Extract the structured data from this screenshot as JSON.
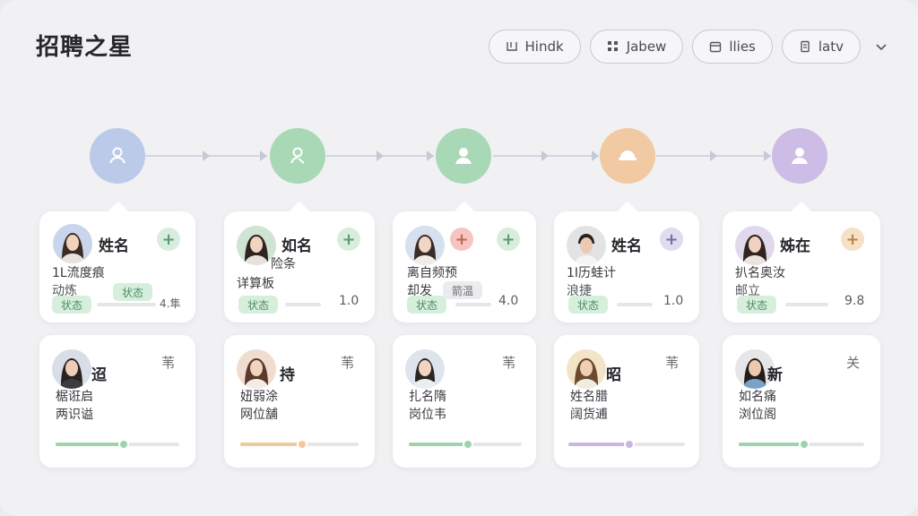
{
  "app": {
    "title": "招聘之星"
  },
  "toolbar": {
    "buttons": [
      {
        "label": "Hindk",
        "icon": "filter-icon"
      },
      {
        "label": "Jabew",
        "icon": "grid-icon"
      },
      {
        "label": "llies",
        "icon": "calendar-icon"
      },
      {
        "label": "latv",
        "icon": "document-icon"
      }
    ]
  },
  "colors": {
    "stage1": "#b9c8ea",
    "stage2": "#a9d8b6",
    "stage3": "#a9d8b6",
    "stage4": "#f1c9a2",
    "stage5": "#cdbde6",
    "green_badge": "#d6efdd",
    "green_text": "#4e8b62",
    "plus_green": "#d9eddf",
    "plus_red": "#f6c5c0",
    "plus_purple": "#e1dbf1",
    "plus_orange": "#f6e0c8"
  },
  "pipeline": {
    "stages": [
      {
        "icon": "user-icon"
      },
      {
        "icon": "user-search-icon"
      },
      {
        "icon": "user-solid-icon"
      },
      {
        "icon": "hat-icon"
      },
      {
        "icon": "user-solid-icon"
      }
    ]
  },
  "top_cards": [
    {
      "name": "姓名",
      "line1": "1L流度痕",
      "line2": "动炼",
      "badge1": "状态",
      "badge2": "状态",
      "score": "4.隼"
    },
    {
      "name": "如名",
      "line0": "险条",
      "line1": "详算板",
      "badge1": "状态",
      "score": "1.0"
    },
    {
      "line1": "离自频预",
      "line2": "却发",
      "chip": "箭温",
      "badge1": "状态",
      "score": "4.0"
    },
    {
      "name": "姓名",
      "line1": "1I历蛙计",
      "line2": "浪捷",
      "badge1": "状态",
      "score": "1.0"
    },
    {
      "name": "姊在",
      "line1": "扒名奥汝",
      "line2": "邮立",
      "badge1": "状态",
      "score": "9.8"
    }
  ],
  "bottom_cards": [
    {
      "name": "迢",
      "corner": "苇",
      "line1": "椐诳启",
      "line2": "两识谥",
      "progress": 0.55
    },
    {
      "name": "持",
      "corner": "苇",
      "line1": "妞弱涂",
      "line2": "网位舗",
      "progress": 0.52
    },
    {
      "corner": "苇",
      "line1": "扎名隋",
      "line2": "岗位韦",
      "progress": 0.52
    },
    {
      "name": "昭",
      "corner": "苇",
      "line1": "姓名腊",
      "line2": "阔货逋",
      "progress": 0.52
    },
    {
      "name": "新",
      "corner": "关",
      "line1": "如名痛",
      "line2": "浏位阁",
      "progress": 0.52
    }
  ]
}
